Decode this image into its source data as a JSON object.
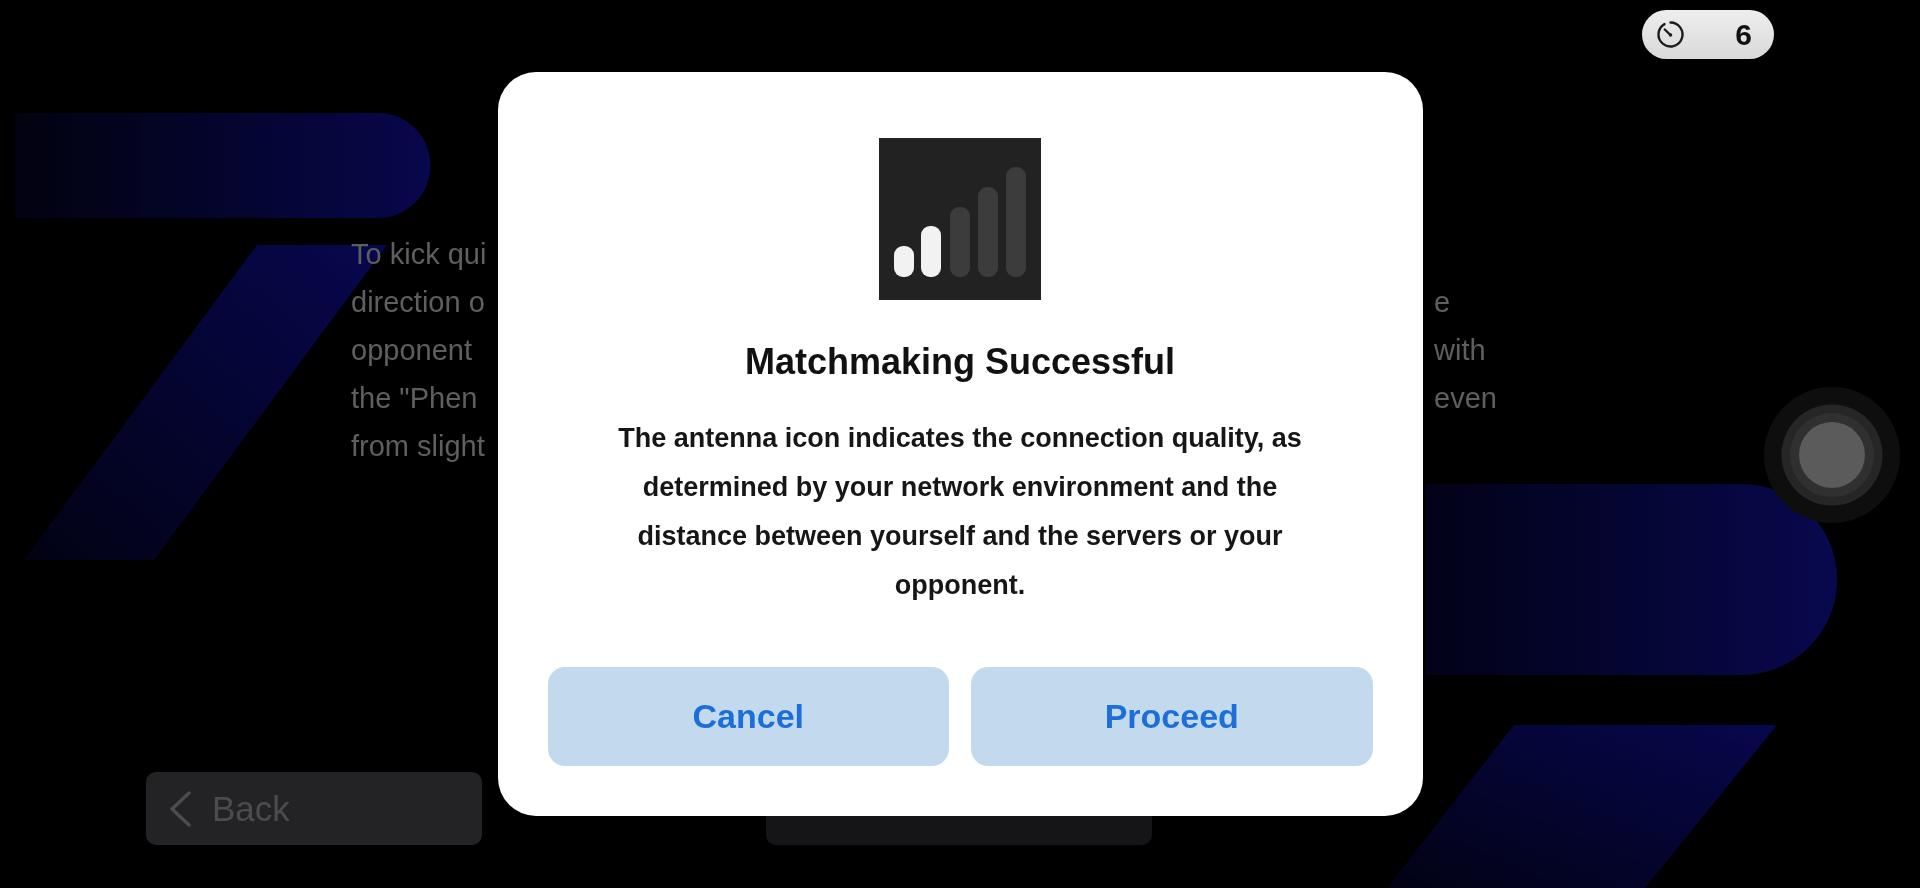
{
  "hud": {
    "timer": "6"
  },
  "tutorial_text": [
    {
      "left": "To kick qui"
    },
    {
      "left": "direction o",
      "right": "e"
    },
    {
      "left": "opponent",
      "right": "with"
    },
    {
      "left": "the \"Phen",
      "right": "even"
    },
    {
      "left": "from slight"
    }
  ],
  "footer": {
    "back_label": "Back"
  },
  "dialog": {
    "title": "Matchmaking Successful",
    "message": "The antenna icon indicates the connection quality, as determined by your network environment and the distance between yourself and the servers or your opponent.",
    "buttons": [
      "Cancel",
      "Proceed"
    ]
  }
}
